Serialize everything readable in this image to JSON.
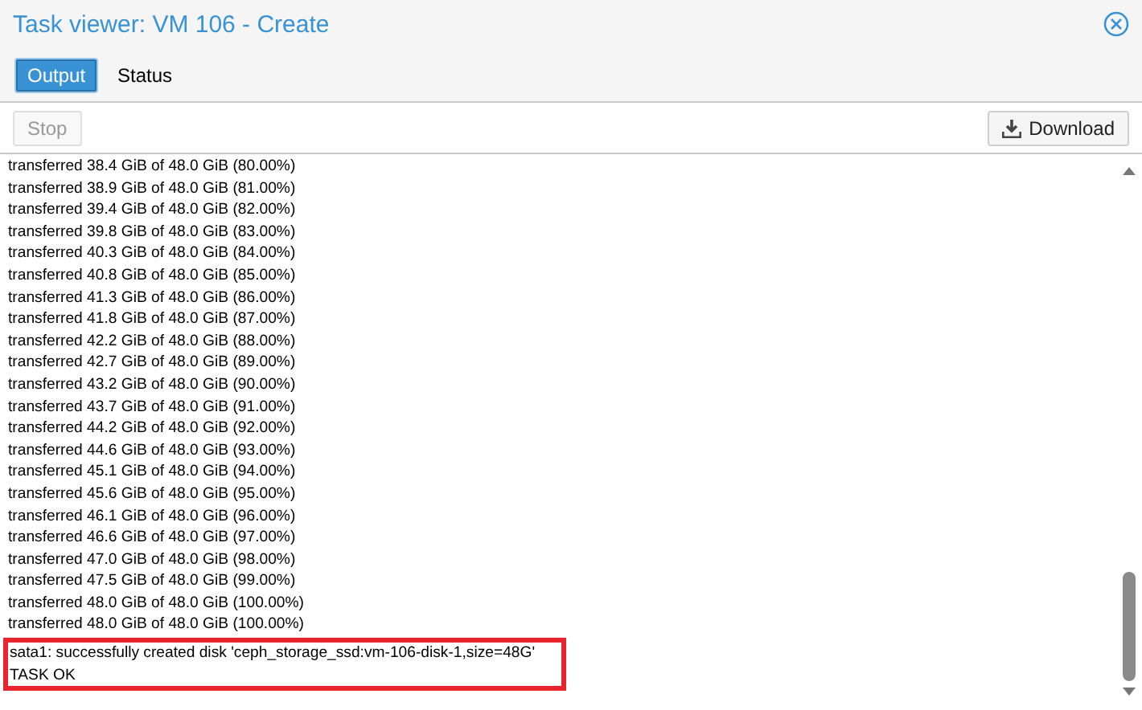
{
  "window": {
    "title": "Task viewer: VM 106 - Create"
  },
  "tabs": [
    {
      "label": "Output",
      "selected": true
    },
    {
      "label": "Status",
      "selected": false
    }
  ],
  "toolbar": {
    "stop": {
      "label": "Stop",
      "disabled": true
    },
    "download": {
      "label": "Download"
    }
  },
  "log": {
    "lines": [
      {
        "text": "transferred 38.4 GiB of 48.0 GiB (80.00%)",
        "highlighted": false
      },
      {
        "text": "transferred 38.9 GiB of 48.0 GiB (81.00%)",
        "highlighted": false
      },
      {
        "text": "transferred 39.4 GiB of 48.0 GiB (82.00%)",
        "highlighted": false
      },
      {
        "text": "transferred 39.8 GiB of 48.0 GiB (83.00%)",
        "highlighted": false
      },
      {
        "text": "transferred 40.3 GiB of 48.0 GiB (84.00%)",
        "highlighted": false
      },
      {
        "text": "transferred 40.8 GiB of 48.0 GiB (85.00%)",
        "highlighted": false
      },
      {
        "text": "transferred 41.3 GiB of 48.0 GiB (86.00%)",
        "highlighted": false
      },
      {
        "text": "transferred 41.8 GiB of 48.0 GiB (87.00%)",
        "highlighted": false
      },
      {
        "text": "transferred 42.2 GiB of 48.0 GiB (88.00%)",
        "highlighted": false
      },
      {
        "text": "transferred 42.7 GiB of 48.0 GiB (89.00%)",
        "highlighted": false
      },
      {
        "text": "transferred 43.2 GiB of 48.0 GiB (90.00%)",
        "highlighted": false
      },
      {
        "text": "transferred 43.7 GiB of 48.0 GiB (91.00%)",
        "highlighted": false
      },
      {
        "text": "transferred 44.2 GiB of 48.0 GiB (92.00%)",
        "highlighted": false
      },
      {
        "text": "transferred 44.6 GiB of 48.0 GiB (93.00%)",
        "highlighted": false
      },
      {
        "text": "transferred 45.1 GiB of 48.0 GiB (94.00%)",
        "highlighted": false
      },
      {
        "text": "transferred 45.6 GiB of 48.0 GiB (95.00%)",
        "highlighted": false
      },
      {
        "text": "transferred 46.1 GiB of 48.0 GiB (96.00%)",
        "highlighted": false
      },
      {
        "text": "transferred 46.6 GiB of 48.0 GiB (97.00%)",
        "highlighted": false
      },
      {
        "text": "transferred 47.0 GiB of 48.0 GiB (98.00%)",
        "highlighted": false
      },
      {
        "text": "transferred 47.5 GiB of 48.0 GiB (99.00%)",
        "highlighted": false
      },
      {
        "text": "transferred 48.0 GiB of 48.0 GiB (100.00%)",
        "highlighted": false
      },
      {
        "text": "transferred 48.0 GiB of 48.0 GiB (100.00%)",
        "highlighted": false
      },
      {
        "text": "sata1: successfully created disk 'ceph_storage_ssd:vm-106-disk-1,size=48G'",
        "highlighted": true
      },
      {
        "text": "TASK OK",
        "highlighted": true
      }
    ]
  }
}
